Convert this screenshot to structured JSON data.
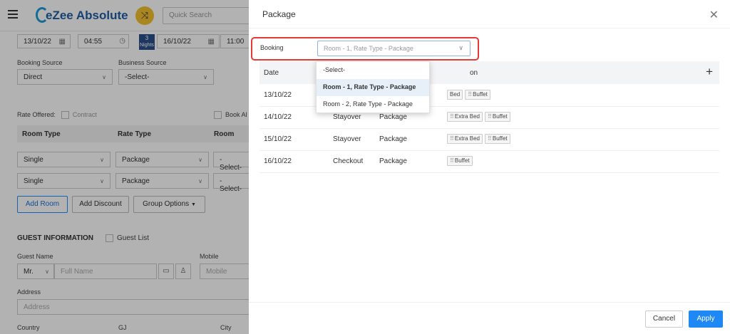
{
  "app": {
    "brand": "eZee Absolute",
    "search_placeholder": "Quick Search"
  },
  "reservation": {
    "arrival_date": "13/10/22",
    "arrival_time": "04:55",
    "nights_count": "3",
    "nights_label": "Nights",
    "departure_date": "16/10/22",
    "departure_time": "11:00",
    "booking_source_label": "Booking Source",
    "booking_source_value": "Direct",
    "business_source_label": "Business Source",
    "business_source_value": "-Select-",
    "rate_offered_label": "Rate Offered:",
    "contract_label": "Contract",
    "book_all_label": "Book Al",
    "columns": [
      "Room Type",
      "Rate Type",
      "Room"
    ],
    "rooms": [
      {
        "room_type": "Single",
        "rate_type": "Package",
        "room": "-Select-"
      },
      {
        "room_type": "Single",
        "rate_type": "Package",
        "room": "-Select-"
      }
    ],
    "add_room": "Add Room",
    "add_discount": "Add Discount",
    "group_options": "Group Options"
  },
  "guest": {
    "section_title": "GUEST INFORMATION",
    "guest_list_label": "Guest List",
    "guest_name_label": "Guest Name",
    "salutation": "Mr.",
    "full_name_placeholder": "Full Name",
    "mobile_label": "Mobile",
    "mobile_placeholder": "Mobile",
    "address_label": "Address",
    "address_placeholder": "Address",
    "country_label": "Country",
    "gj_label": "GJ",
    "city_label": "City"
  },
  "modal": {
    "title": "Package",
    "booking_label": "Booking",
    "booking_value": "Room - 1, Rate Type - Package",
    "dropdown_options": [
      "-Select-",
      "Room - 1, Rate Type - Package",
      "Room - 2, Rate Type - Package"
    ],
    "selected_option_index": 1,
    "table_headers": {
      "date": "Date",
      "description_fragment": "on"
    },
    "rows": [
      {
        "date": "13/10/22",
        "stay": "",
        "rate": "",
        "items": [
          "Bed",
          "Buffet"
        ]
      },
      {
        "date": "14/10/22",
        "stay": "Stayover",
        "rate": "Package",
        "items": [
          "Extra Bed",
          "Buffet"
        ]
      },
      {
        "date": "15/10/22",
        "stay": "Stayover",
        "rate": "Package",
        "items": [
          "Extra Bed",
          "Buffet"
        ]
      },
      {
        "date": "16/10/22",
        "stay": "Checkout",
        "rate": "Package",
        "items": [
          "Buffet"
        ]
      }
    ],
    "cancel_label": "Cancel",
    "apply_label": "Apply"
  }
}
